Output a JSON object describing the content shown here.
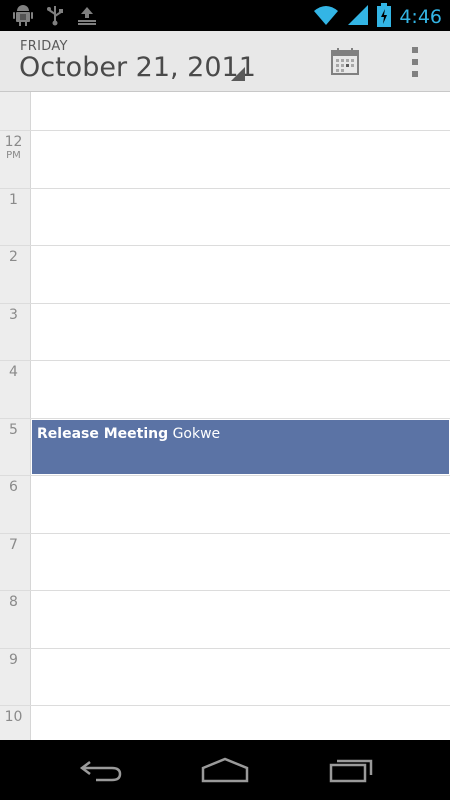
{
  "status_bar": {
    "time": "4:46",
    "left_icons": [
      "android-debug-icon",
      "usb-icon",
      "download-icon"
    ],
    "right_icons": [
      "wifi-icon",
      "signal-icon",
      "battery-charging-icon"
    ]
  },
  "action_bar": {
    "weekday": "FRIDAY",
    "date": "October 21, 2011",
    "actions": [
      "today-calendar-icon",
      "overflow-menu-icon"
    ]
  },
  "day_view": {
    "hours": [
      {
        "label": "12",
        "ampm": "PM"
      },
      {
        "label": "1"
      },
      {
        "label": "2"
      },
      {
        "label": "3"
      },
      {
        "label": "4"
      },
      {
        "label": "5"
      },
      {
        "label": "6"
      },
      {
        "label": "7"
      },
      {
        "label": "8"
      },
      {
        "label": "9"
      },
      {
        "label": "10"
      }
    ],
    "events": [
      {
        "title": "Release Meeting",
        "location": "Gokwe",
        "color": "#5b73a5"
      }
    ]
  },
  "nav_bar": {
    "buttons": [
      "back-icon",
      "home-icon",
      "recents-icon"
    ]
  },
  "colors": {
    "accent": "#33b5e5",
    "event": "#5b73a5"
  }
}
